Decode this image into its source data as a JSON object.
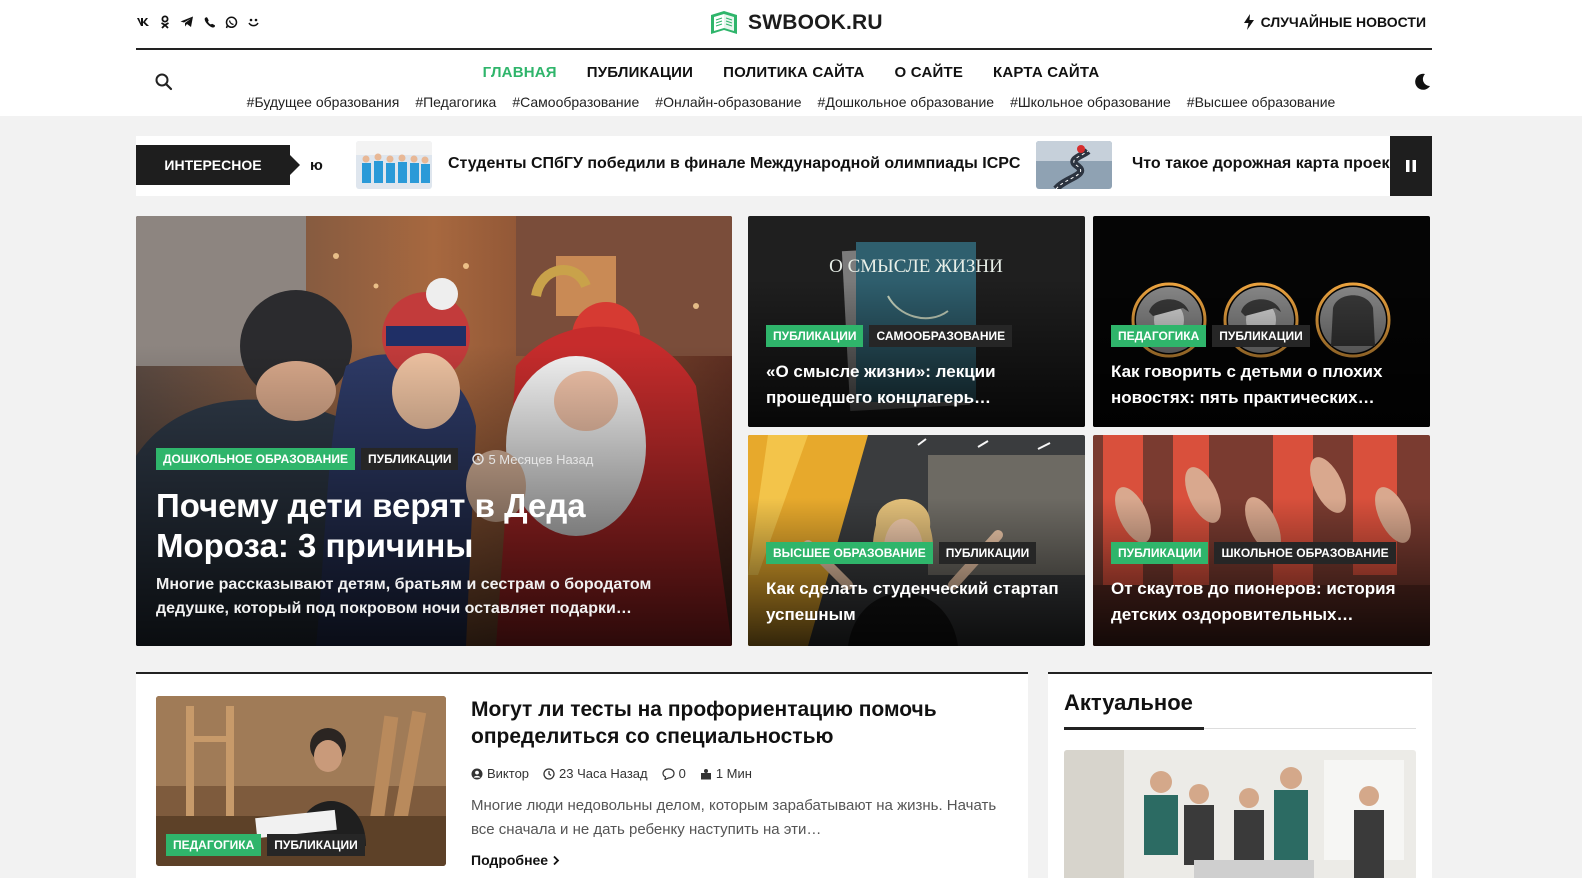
{
  "header": {
    "socials": [
      {
        "icon": "vk-icon",
        "glyph": "vk"
      },
      {
        "icon": "ok-icon",
        "glyph": "ok"
      },
      {
        "icon": "telegram-icon",
        "glyph": "tg"
      },
      {
        "icon": "viber-icon",
        "glyph": "vb"
      },
      {
        "icon": "whatsapp-icon",
        "glyph": "wa"
      },
      {
        "icon": "yandex-zen-icon",
        "glyph": "zen"
      }
    ],
    "logo_text": "SWBOOK.RU",
    "random_news": "СЛУЧАЙНЫЕ НОВОСТИ",
    "nav": [
      "ГЛАВНАЯ",
      "ПУБЛИКАЦИИ",
      "ПОЛИТИКА САЙТА",
      "О САЙТЕ",
      "КАРТА САЙТА"
    ],
    "active_nav": "ГЛАВНАЯ",
    "tags": [
      "#Будущее образования",
      "#Педагогика",
      "#Самообразование",
      "#Онлайн-образование",
      "#Дошкольное образование",
      "#Школьное образование",
      "#Высшее образование"
    ]
  },
  "ticker": {
    "label": "ИНТЕРЕСНОЕ",
    "fragment": "ю",
    "items": [
      "Студенты СПбГУ победили в финале Международной олимпиады ICPC",
      "Что такое дорожная карта проекта"
    ]
  },
  "featured": {
    "main": {
      "badges": [
        "ДОШКОЛЬНОЕ ОБРАЗОВАНИЕ",
        "ПУБЛИКАЦИИ"
      ],
      "time": "5 Месяцев Назад",
      "title": "Почему дети верят в Деда Мороза: 3 причины",
      "desc": "Многие рассказывают детям, братьям и сестрам о бородатом дедушке, который под покровом ночи оставляет подарки…"
    },
    "c1": {
      "badges": [
        "ПУБЛИКАЦИИ",
        "САМООБРАЗОВАНИЕ"
      ],
      "title": "«О смысле жизни»: лекции прошедшего концлагерь…",
      "book_text": "О СМЫСЛЕ ЖИЗНИ"
    },
    "c2": {
      "badges": [
        "ПЕДАГОГИКА",
        "ПУБЛИКАЦИИ"
      ],
      "title": "Как говорить с детьми о плохих новостях: пять практических…"
    },
    "c3": {
      "badges": [
        "ВЫСШЕЕ ОБРАЗОВАНИЕ",
        "ПУБЛИКАЦИИ"
      ],
      "title": "Как сделать студенческий стартап успешным"
    },
    "c4": {
      "badges": [
        "ПУБЛИКАЦИИ",
        "ШКОЛЬНОЕ ОБРАЗОВАНИЕ"
      ],
      "title": "От скаутов до пионеров: история детских оздоровительных…"
    }
  },
  "article": {
    "badges": [
      "ПЕДАГОГИКА",
      "ПУБЛИКАЦИИ"
    ],
    "title": "Могут ли тесты на профориентацию помочь определиться со специальностью",
    "author": "Виктор",
    "time": "23 Часа Назад",
    "comments": "0",
    "read": "1 Мин",
    "desc": "Многие люди недовольны делом, которым зарабатывают на жизнь. Начать все сначала и не дать ребенку наступить на эти…",
    "more": "Подробнее"
  },
  "sidebar": {
    "title": "Актуальное"
  },
  "colors": {
    "accent": "#2fb56b",
    "dark": "#1e1e1e"
  }
}
